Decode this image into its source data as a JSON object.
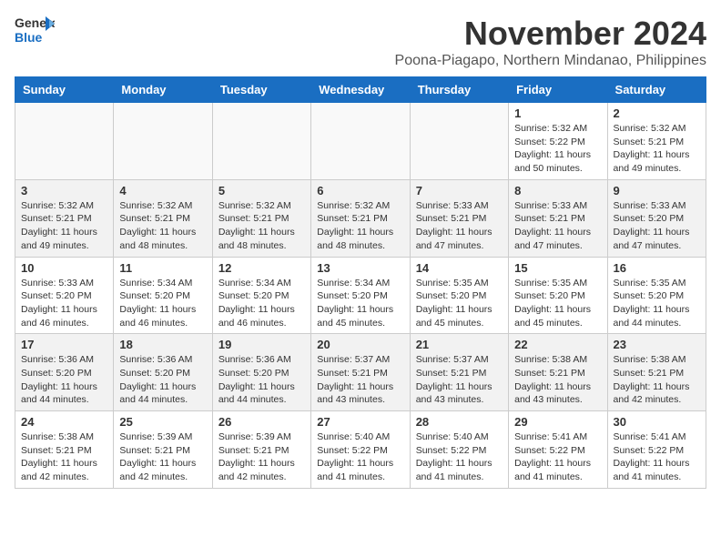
{
  "logo": {
    "general": "General",
    "blue": "Blue"
  },
  "title": "November 2024",
  "location": "Poona-Piagapo, Northern Mindanao, Philippines",
  "weekdays": [
    "Sunday",
    "Monday",
    "Tuesday",
    "Wednesday",
    "Thursday",
    "Friday",
    "Saturday"
  ],
  "weeks": [
    [
      {
        "day": "",
        "info": ""
      },
      {
        "day": "",
        "info": ""
      },
      {
        "day": "",
        "info": ""
      },
      {
        "day": "",
        "info": ""
      },
      {
        "day": "",
        "info": ""
      },
      {
        "day": "1",
        "info": "Sunrise: 5:32 AM\nSunset: 5:22 PM\nDaylight: 11 hours\nand 50 minutes."
      },
      {
        "day": "2",
        "info": "Sunrise: 5:32 AM\nSunset: 5:21 PM\nDaylight: 11 hours\nand 49 minutes."
      }
    ],
    [
      {
        "day": "3",
        "info": "Sunrise: 5:32 AM\nSunset: 5:21 PM\nDaylight: 11 hours\nand 49 minutes."
      },
      {
        "day": "4",
        "info": "Sunrise: 5:32 AM\nSunset: 5:21 PM\nDaylight: 11 hours\nand 48 minutes."
      },
      {
        "day": "5",
        "info": "Sunrise: 5:32 AM\nSunset: 5:21 PM\nDaylight: 11 hours\nand 48 minutes."
      },
      {
        "day": "6",
        "info": "Sunrise: 5:32 AM\nSunset: 5:21 PM\nDaylight: 11 hours\nand 48 minutes."
      },
      {
        "day": "7",
        "info": "Sunrise: 5:33 AM\nSunset: 5:21 PM\nDaylight: 11 hours\nand 47 minutes."
      },
      {
        "day": "8",
        "info": "Sunrise: 5:33 AM\nSunset: 5:21 PM\nDaylight: 11 hours\nand 47 minutes."
      },
      {
        "day": "9",
        "info": "Sunrise: 5:33 AM\nSunset: 5:20 PM\nDaylight: 11 hours\nand 47 minutes."
      }
    ],
    [
      {
        "day": "10",
        "info": "Sunrise: 5:33 AM\nSunset: 5:20 PM\nDaylight: 11 hours\nand 46 minutes."
      },
      {
        "day": "11",
        "info": "Sunrise: 5:34 AM\nSunset: 5:20 PM\nDaylight: 11 hours\nand 46 minutes."
      },
      {
        "day": "12",
        "info": "Sunrise: 5:34 AM\nSunset: 5:20 PM\nDaylight: 11 hours\nand 46 minutes."
      },
      {
        "day": "13",
        "info": "Sunrise: 5:34 AM\nSunset: 5:20 PM\nDaylight: 11 hours\nand 45 minutes."
      },
      {
        "day": "14",
        "info": "Sunrise: 5:35 AM\nSunset: 5:20 PM\nDaylight: 11 hours\nand 45 minutes."
      },
      {
        "day": "15",
        "info": "Sunrise: 5:35 AM\nSunset: 5:20 PM\nDaylight: 11 hours\nand 45 minutes."
      },
      {
        "day": "16",
        "info": "Sunrise: 5:35 AM\nSunset: 5:20 PM\nDaylight: 11 hours\nand 44 minutes."
      }
    ],
    [
      {
        "day": "17",
        "info": "Sunrise: 5:36 AM\nSunset: 5:20 PM\nDaylight: 11 hours\nand 44 minutes."
      },
      {
        "day": "18",
        "info": "Sunrise: 5:36 AM\nSunset: 5:20 PM\nDaylight: 11 hours\nand 44 minutes."
      },
      {
        "day": "19",
        "info": "Sunrise: 5:36 AM\nSunset: 5:20 PM\nDaylight: 11 hours\nand 44 minutes."
      },
      {
        "day": "20",
        "info": "Sunrise: 5:37 AM\nSunset: 5:21 PM\nDaylight: 11 hours\nand 43 minutes."
      },
      {
        "day": "21",
        "info": "Sunrise: 5:37 AM\nSunset: 5:21 PM\nDaylight: 11 hours\nand 43 minutes."
      },
      {
        "day": "22",
        "info": "Sunrise: 5:38 AM\nSunset: 5:21 PM\nDaylight: 11 hours\nand 43 minutes."
      },
      {
        "day": "23",
        "info": "Sunrise: 5:38 AM\nSunset: 5:21 PM\nDaylight: 11 hours\nand 42 minutes."
      }
    ],
    [
      {
        "day": "24",
        "info": "Sunrise: 5:38 AM\nSunset: 5:21 PM\nDaylight: 11 hours\nand 42 minutes."
      },
      {
        "day": "25",
        "info": "Sunrise: 5:39 AM\nSunset: 5:21 PM\nDaylight: 11 hours\nand 42 minutes."
      },
      {
        "day": "26",
        "info": "Sunrise: 5:39 AM\nSunset: 5:21 PM\nDaylight: 11 hours\nand 42 minutes."
      },
      {
        "day": "27",
        "info": "Sunrise: 5:40 AM\nSunset: 5:22 PM\nDaylight: 11 hours\nand 41 minutes."
      },
      {
        "day": "28",
        "info": "Sunrise: 5:40 AM\nSunset: 5:22 PM\nDaylight: 11 hours\nand 41 minutes."
      },
      {
        "day": "29",
        "info": "Sunrise: 5:41 AM\nSunset: 5:22 PM\nDaylight: 11 hours\nand 41 minutes."
      },
      {
        "day": "30",
        "info": "Sunrise: 5:41 AM\nSunset: 5:22 PM\nDaylight: 11 hours\nand 41 minutes."
      }
    ]
  ]
}
